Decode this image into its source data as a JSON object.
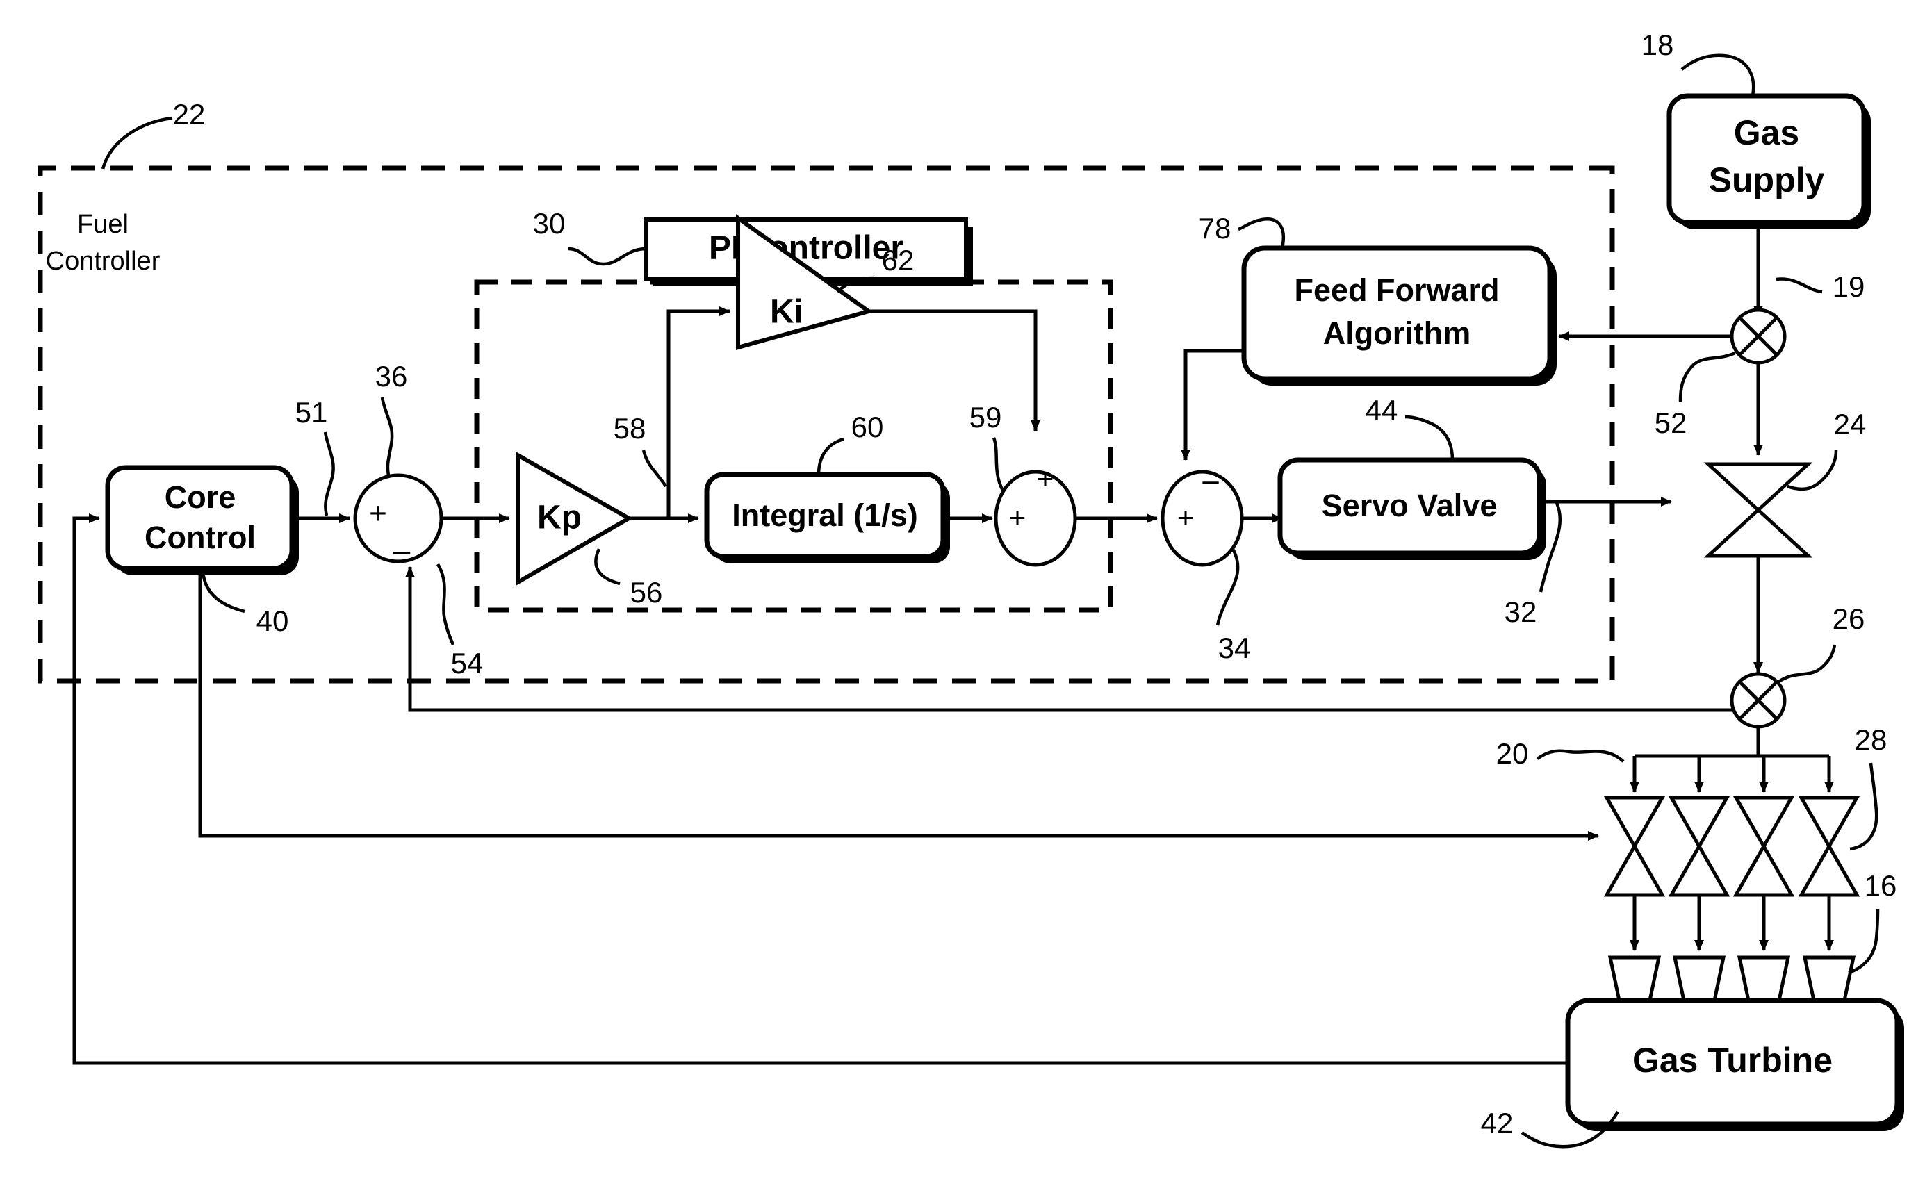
{
  "figure": {
    "type": "patent-control-block-diagram",
    "background": "#ffffff",
    "stroke": "#000000"
  },
  "blocks": {
    "core_control": {
      "label": "Core\nControl",
      "line1": "Core",
      "line2": "Control",
      "ref": "40"
    },
    "integral": {
      "label": "Integral (1/s)",
      "ref": "60"
    },
    "servo_valve": {
      "label": "Servo Valve",
      "ref": "44"
    },
    "feed_forward": {
      "line1": "Feed Forward",
      "line2": "Algorithm",
      "ref": "78"
    },
    "gas_supply": {
      "line1": "Gas",
      "line2": "Supply",
      "ref": "18"
    },
    "gas_turbine": {
      "label": "Gas Turbine",
      "ref": "42"
    },
    "pi_controller_title": {
      "label": "PI controller",
      "ref": "30"
    },
    "fuel_controller": {
      "line1": "Fuel",
      "line2": "Controller",
      "ref": "22"
    }
  },
  "gains": {
    "kp": {
      "label": "Kp",
      "ref": "56"
    },
    "ki": {
      "label": "Ki",
      "ref": "62"
    }
  },
  "junctions": {
    "j36": {
      "ref": "36",
      "left_sign": "+",
      "bottom_sign": "–"
    },
    "j59": {
      "ref": "59",
      "left_sign": "+",
      "top_sign": "+"
    },
    "j34": {
      "ref": "34",
      "left_sign": "+",
      "top_sign": "–"
    }
  },
  "signal_refs": {
    "s51": "51",
    "s58": "58",
    "s54": "54",
    "s32": "32",
    "s19": "19",
    "s52": "52",
    "s24": "24",
    "s26": "26",
    "s20": "20",
    "s28": "28",
    "s16": "16"
  },
  "callouts": [
    {
      "id": "c22",
      "text": "22"
    },
    {
      "id": "c30",
      "text": "30"
    },
    {
      "id": "c18",
      "text": "18"
    },
    {
      "id": "c19",
      "text": "19"
    },
    {
      "id": "c52",
      "text": "52"
    },
    {
      "id": "c24",
      "text": "24"
    },
    {
      "id": "c26",
      "text": "26"
    },
    {
      "id": "c36",
      "text": "36"
    },
    {
      "id": "c51",
      "text": "51"
    },
    {
      "id": "c40",
      "text": "40"
    },
    {
      "id": "c54",
      "text": "54"
    },
    {
      "id": "c56",
      "text": "56"
    },
    {
      "id": "c58",
      "text": "58"
    },
    {
      "id": "c60",
      "text": "60"
    },
    {
      "id": "c62",
      "text": "62"
    },
    {
      "id": "c59",
      "text": "59"
    },
    {
      "id": "c34",
      "text": "34"
    },
    {
      "id": "c44",
      "text": "44"
    },
    {
      "id": "c78",
      "text": "78"
    },
    {
      "id": "c32",
      "text": "32"
    },
    {
      "id": "c20",
      "text": "20"
    },
    {
      "id": "c28",
      "text": "28"
    },
    {
      "id": "c16",
      "text": "16"
    },
    {
      "id": "c42",
      "text": "42"
    }
  ]
}
